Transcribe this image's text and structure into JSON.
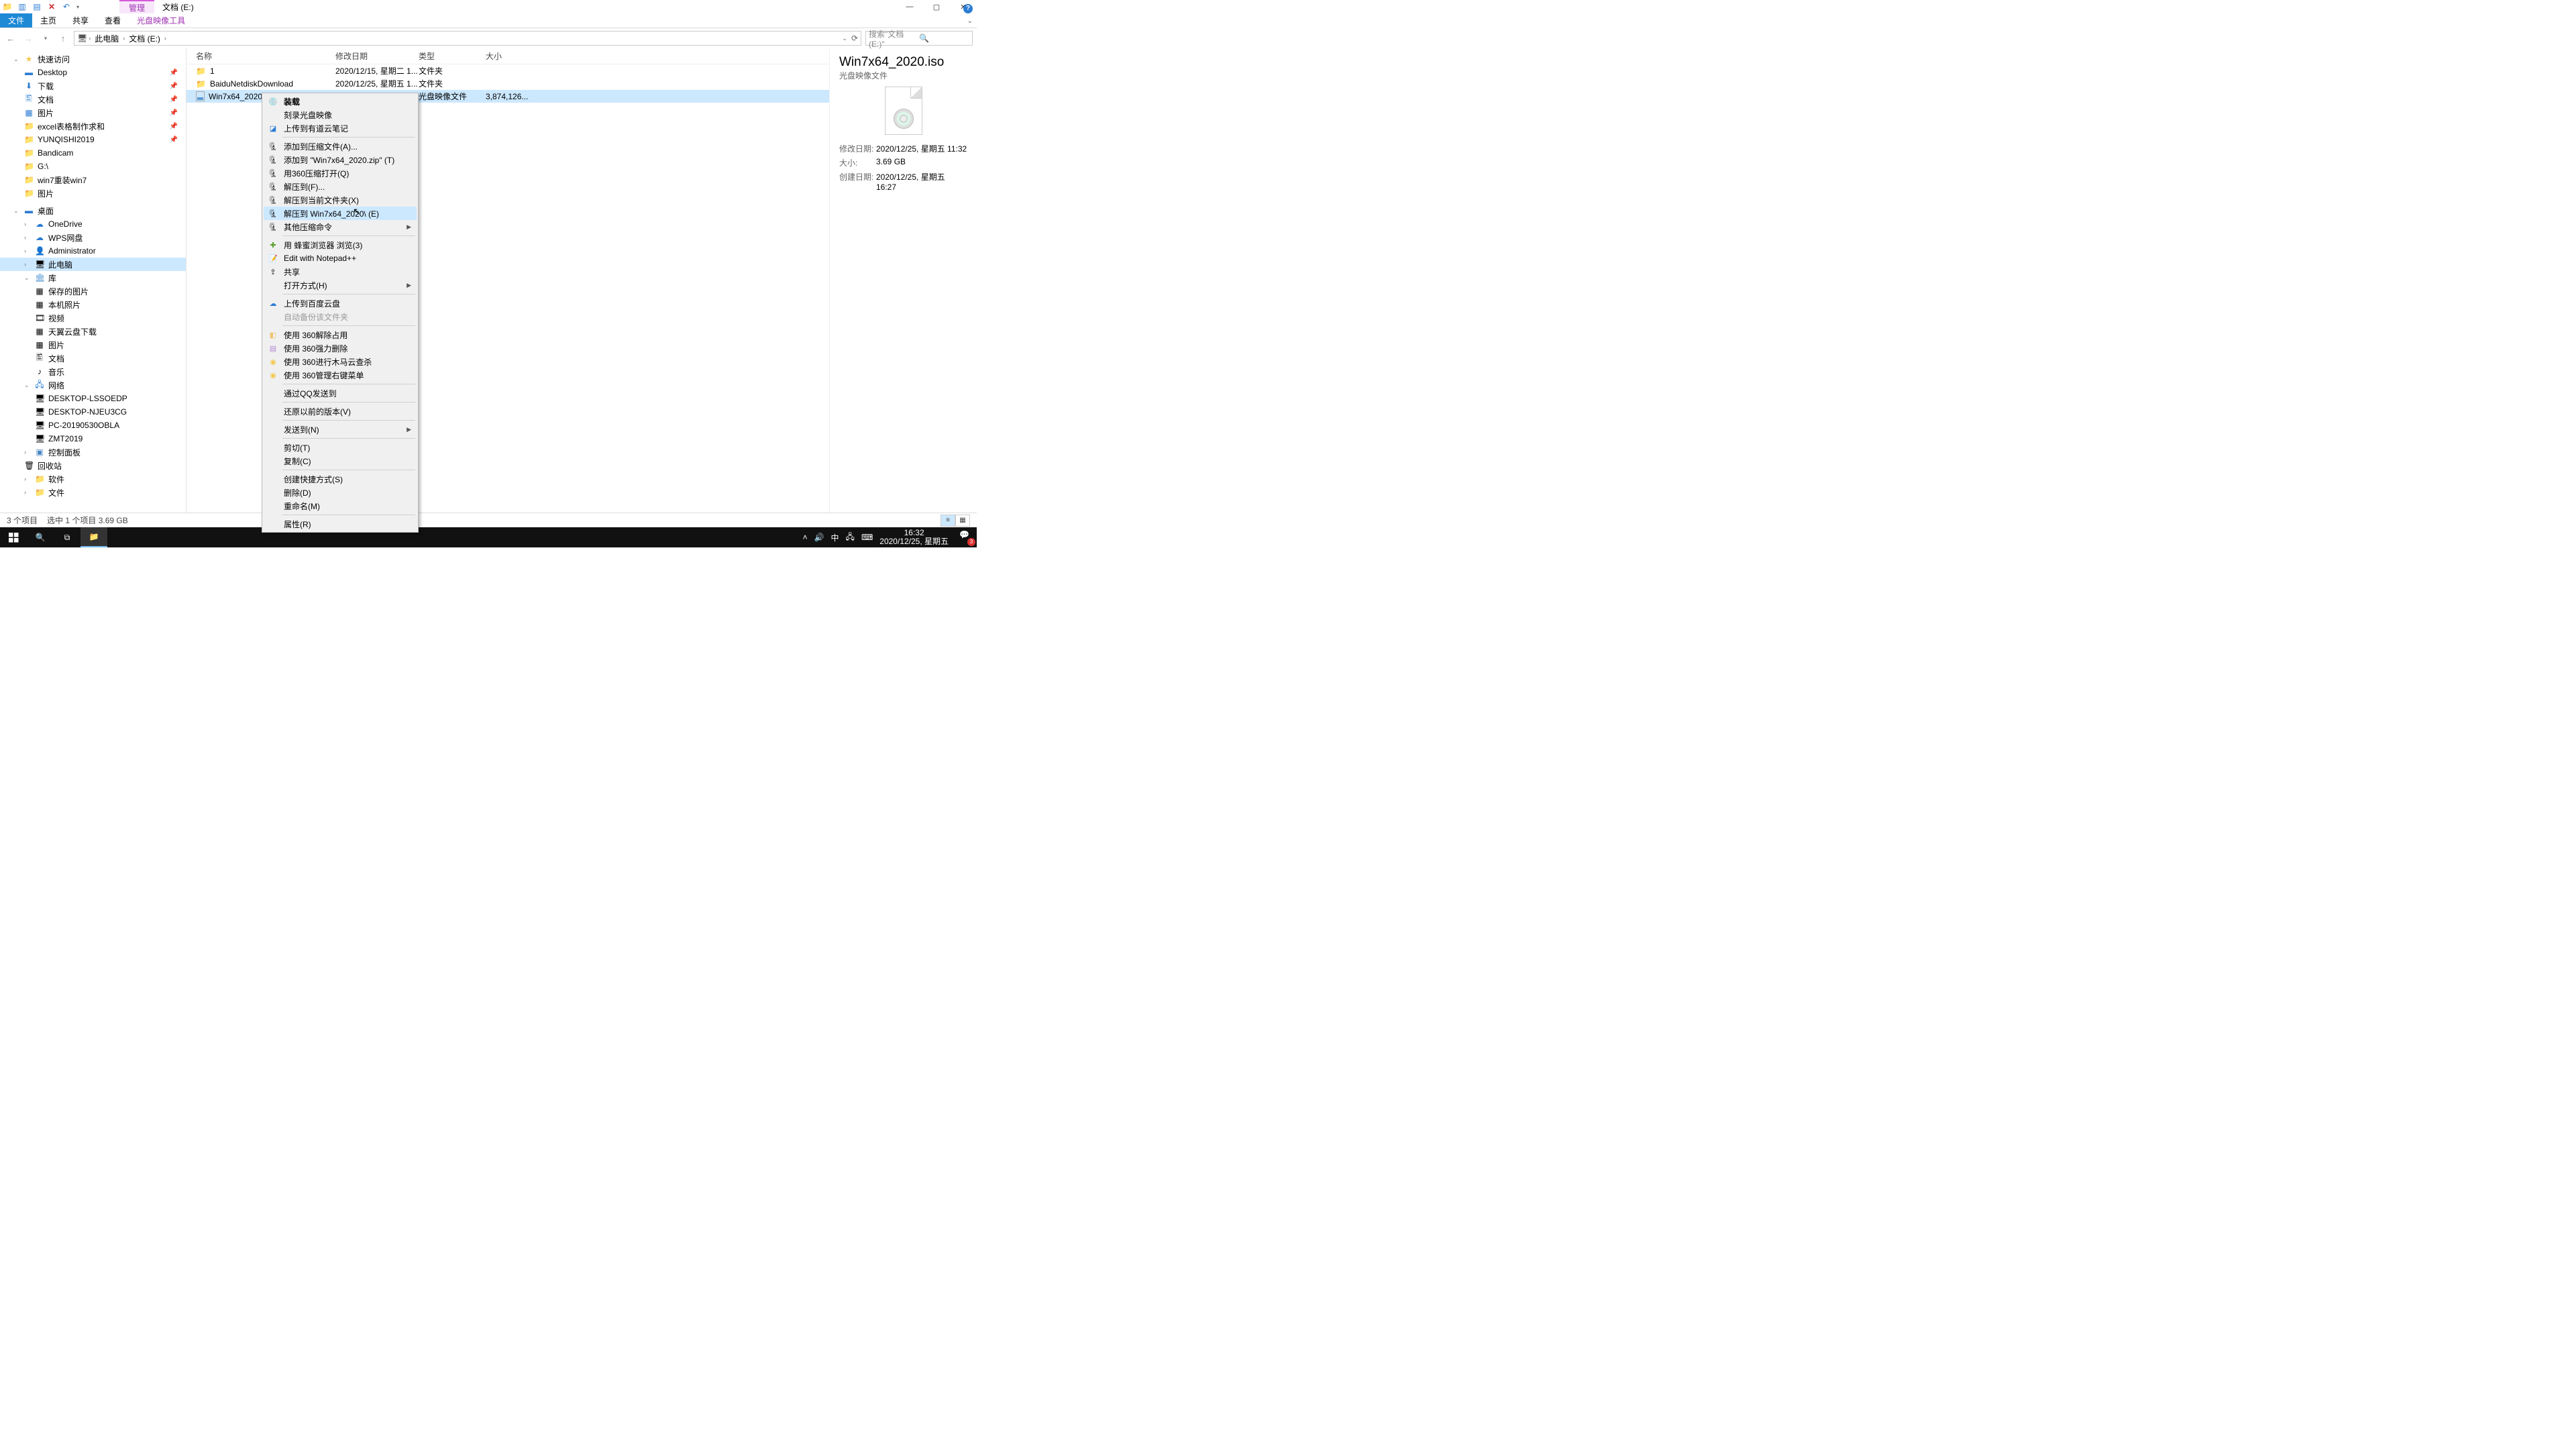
{
  "titlebar": {
    "tab_highlight": "管理",
    "title": "文档 (E:)"
  },
  "win": {
    "min": "—",
    "max": "▢",
    "close": "✕"
  },
  "ribbon": {
    "file": "文件",
    "home": "主页",
    "share": "共享",
    "view": "查看",
    "tool": "光盘映像工具"
  },
  "addr": {
    "root": "此电脑",
    "loc": "文档 (E:)"
  },
  "search": {
    "placeholder": "搜索\"文档 (E:)\""
  },
  "nav": {
    "quick": "快速访问",
    "desktop": "Desktop",
    "downloads": "下载",
    "docs": "文档",
    "pics": "图片",
    "excel": "excel表格制作求和",
    "yunqishi": "YUNQISHI2019",
    "bandicam": "Bandicam",
    "g": "G:\\",
    "win7r": "win7重装win7",
    "pics2": "图片",
    "desk_group": "桌面",
    "onedrive": "OneDrive",
    "wps": "WPS网盘",
    "admin": "Administrator",
    "pc": "此电脑",
    "lib": "库",
    "saved": "保存的图片",
    "local": "本机照片",
    "video": "视频",
    "tianyi": "天翼云盘下载",
    "pics3": "图片",
    "docs2": "文档",
    "music": "音乐",
    "net": "网络",
    "n1": "DESKTOP-LSSOEDP",
    "n2": "DESKTOP-NJEU3CG",
    "n3": "PC-20190530OBLA",
    "n4": "ZMT2019",
    "ctrl": "控制面板",
    "recycle": "回收站",
    "soft": "软件",
    "file": "文件"
  },
  "cols": {
    "name": "名称",
    "date": "修改日期",
    "type": "类型",
    "size": "大小"
  },
  "files": [
    {
      "name": "1",
      "date": "2020/12/15, 星期二 1...",
      "type": "文件夹",
      "size": ""
    },
    {
      "name": "BaiduNetdiskDownload",
      "date": "2020/12/25, 星期五 1...",
      "type": "文件夹",
      "size": ""
    },
    {
      "name": "Win7x64_2020.iso",
      "date": "2020/12/25, 星期五 1...",
      "type": "光盘映像文件",
      "size": "3,874,126..."
    }
  ],
  "details": {
    "title": "Win7x64_2020.iso",
    "sub": "光盘映像文件",
    "mod_l": "修改日期:",
    "mod_v": "2020/12/25, 星期五 11:32",
    "size_l": "大小:",
    "size_v": "3.69 GB",
    "cre_l": "创建日期:",
    "cre_v": "2020/12/25, 星期五 16:27"
  },
  "ctx": {
    "mount": "装载",
    "burn": "刻录光盘映像",
    "youdao": "上传到有道云笔记",
    "addzip": "添加到压缩文件(A)...",
    "addzipn": "添加到 \"Win7x64_2020.zip\" (T)",
    "open360": "用360压缩打开(Q)",
    "extract": "解压到(F)...",
    "extracth": "解压到当前文件夹(X)",
    "extractn": "解压到 Win7x64_2020\\ (E)",
    "otherzip": "其他压缩命令",
    "bee": "用 蜂蜜浏览器 浏览(3)",
    "npp": "Edit with Notepad++",
    "share": "共享",
    "openw": "打开方式(H)",
    "baidu": "上传到百度云盘",
    "autobak": "自动备份该文件夹",
    "u360a": "使用 360解除占用",
    "u360b": "使用 360强力删除",
    "u360c": "使用 360进行木马云查杀",
    "u360d": "使用 360管理右键菜单",
    "qq": "通过QQ发送到",
    "restore": "还原以前的版本(V)",
    "sendto": "发送到(N)",
    "cut": "剪切(T)",
    "copy": "复制(C)",
    "shortcut": "创建快捷方式(S)",
    "del": "删除(D)",
    "rename": "重命名(M)",
    "prop": "属性(R)"
  },
  "status": {
    "count": "3 个项目",
    "sel": "选中 1 个项目  3.69 GB"
  },
  "clock": {
    "time": "16:32",
    "date": "2020/12/25, 星期五"
  },
  "ime": "中",
  "badge": "3"
}
